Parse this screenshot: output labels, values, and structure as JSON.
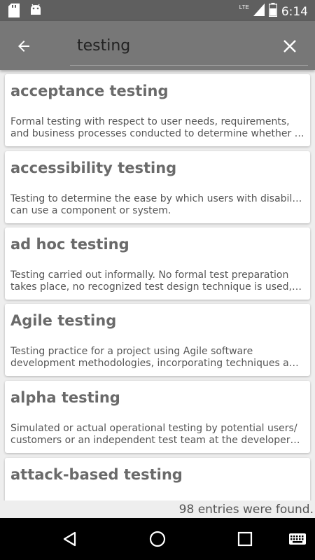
{
  "status_bar": {
    "time": "6:14",
    "network": "LTE",
    "icons": [
      "sd-card-icon",
      "android-icon",
      "signal-icon",
      "battery-icon"
    ]
  },
  "app_bar": {
    "search_value": "testing",
    "back_icon": "arrow-left-icon",
    "clear_icon": "close-icon"
  },
  "results": [
    {
      "term": "acceptance testing",
      "desc_lines": [
        "Formal testing with respect to user needs, requirements,",
        "and business processes conducted to determine whether or …"
      ]
    },
    {
      "term": "accessibility testing",
      "desc_lines": [
        "Testing to determine the ease by which users with disabilities",
        "can use a component or system."
      ]
    },
    {
      "term": "ad hoc testing",
      "desc_lines": [
        "Testing carried out informally. No formal test preparation",
        "takes place, no recognized test design technique is used, ther…"
      ]
    },
    {
      "term": "Agile testing",
      "desc_lines": [
        "Testing practice for a project using Agile software",
        "development methodologies, incorporating techniques and …"
      ]
    },
    {
      "term": "alpha testing",
      "desc_lines": [
        "Simulated or actual operational testing by potential users/",
        "customers or an independent test team at the developers' sit…"
      ]
    },
    {
      "term": "attack-based testing",
      "desc_lines": []
    }
  ],
  "footer": {
    "count_text": "98 entries were found."
  },
  "nav_bar": {
    "icons": [
      "back-triangle-icon",
      "home-circle-icon",
      "recents-square-icon",
      "keyboard-icon"
    ]
  },
  "colors": {
    "status_bar": "#5f5f5f",
    "app_bar": "#777777",
    "background": "#eeeeee",
    "term_text": "#6a6a6a"
  }
}
